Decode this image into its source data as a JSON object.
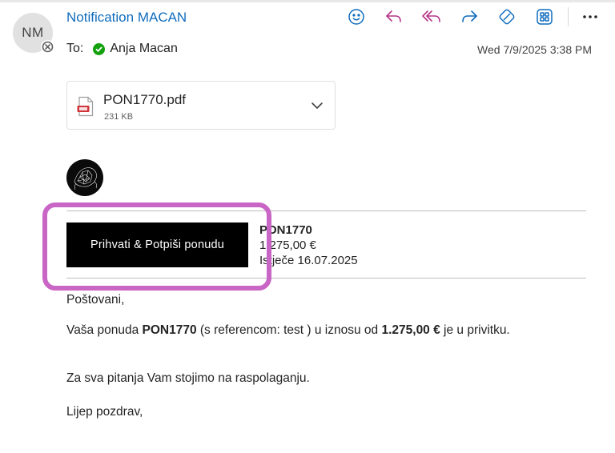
{
  "email": {
    "sender_initials": "NM",
    "subject": "Notification MACAN",
    "to_label": "To:",
    "recipient": "Anja Macan",
    "date": "Wed 7/9/2025 3:38 PM"
  },
  "toolbar": {
    "buttons": [
      "emoji-icon",
      "reply-icon",
      "reply-all-icon",
      "forward-icon",
      "sticker-icon",
      "apps-icon",
      "more-icon"
    ]
  },
  "attachment": {
    "name": "PON1770.pdf",
    "size": "231 KB"
  },
  "offer": {
    "button_label": "Prihvati & Potpiši ponudu",
    "number": "PON1770",
    "amount": "1.275,00 €",
    "expiry": "Istječe 16.07.2025"
  },
  "body": {
    "greeting": "Poštovani,",
    "p1_prefix": "Vaša ponuda ",
    "p1_offer": "PON1770",
    "p1_middle": " (s referencom: test ) u iznosu od ",
    "p1_amount": "1.275,00 €",
    "p1_suffix": " je u privitku.",
    "p2": "Za sva pitanja Vam stojimo na raspolaganju.",
    "closing": "Lijep pozdrav,"
  },
  "colors": {
    "accent": "#0f6cbd",
    "highlight": "#c965c4",
    "presence_green": "#13a10e",
    "button_bg": "#000000"
  }
}
